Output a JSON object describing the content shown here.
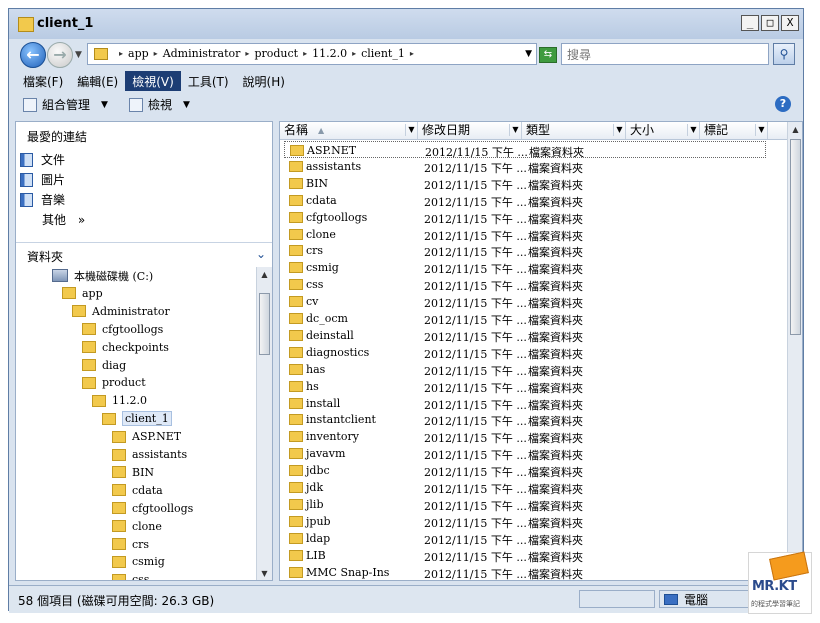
{
  "window": {
    "title": "client_1",
    "buttons": {
      "minimize": "_",
      "maximize": "□",
      "close": "X"
    }
  },
  "address": {
    "breadcrumb": [
      "app",
      "Administrator",
      "product",
      "11.2.0",
      "client_1"
    ],
    "search_placeholder": "搜尋"
  },
  "menubar": [
    "檔案(F)",
    "編輯(E)",
    "檢視(V)",
    "工具(T)",
    "說明(H)"
  ],
  "toolbar": {
    "organize": "組合管理",
    "views": "檢視"
  },
  "favorites": {
    "title": "最愛的連結",
    "items": [
      "文件",
      "圖片",
      "音樂"
    ],
    "more": "其他",
    "more_glyph": "»"
  },
  "folders": {
    "title": "資料夾",
    "tree": [
      {
        "label": "本機磁碟機 (C:)",
        "level": 0,
        "icon": "drive-icon"
      },
      {
        "label": "app",
        "level": 1
      },
      {
        "label": "Administrator",
        "level": 2
      },
      {
        "label": "cfgtoollogs",
        "level": 3
      },
      {
        "label": "checkpoints",
        "level": 3
      },
      {
        "label": "diag",
        "level": 3
      },
      {
        "label": "product",
        "level": 3
      },
      {
        "label": "11.2.0",
        "level": 4
      },
      {
        "label": "client_1",
        "level": 5,
        "selected": true
      },
      {
        "label": "ASP.NET",
        "level": 6
      },
      {
        "label": "assistants",
        "level": 6
      },
      {
        "label": "BIN",
        "level": 6
      },
      {
        "label": "cdata",
        "level": 6
      },
      {
        "label": "cfgtoollogs",
        "level": 6
      },
      {
        "label": "clone",
        "level": 6
      },
      {
        "label": "crs",
        "level": 6
      },
      {
        "label": "csmig",
        "level": 6
      },
      {
        "label": "css",
        "level": 6
      }
    ]
  },
  "columns": [
    "名稱",
    "修改日期",
    "類型",
    "大小",
    "標記"
  ],
  "files": [
    {
      "name": "ASP.NET",
      "date": "2012/11/15 下午 ...",
      "type": "檔案資料夾"
    },
    {
      "name": "assistants",
      "date": "2012/11/15 下午 ...",
      "type": "檔案資料夾"
    },
    {
      "name": "BIN",
      "date": "2012/11/15 下午 ...",
      "type": "檔案資料夾"
    },
    {
      "name": "cdata",
      "date": "2012/11/15 下午 ...",
      "type": "檔案資料夾"
    },
    {
      "name": "cfgtoollogs",
      "date": "2012/11/15 下午 ...",
      "type": "檔案資料夾"
    },
    {
      "name": "clone",
      "date": "2012/11/15 下午 ...",
      "type": "檔案資料夾"
    },
    {
      "name": "crs",
      "date": "2012/11/15 下午 ...",
      "type": "檔案資料夾"
    },
    {
      "name": "csmig",
      "date": "2012/11/15 下午 ...",
      "type": "檔案資料夾"
    },
    {
      "name": "css",
      "date": "2012/11/15 下午 ...",
      "type": "檔案資料夾"
    },
    {
      "name": "cv",
      "date": "2012/11/15 下午 ...",
      "type": "檔案資料夾"
    },
    {
      "name": "dc_ocm",
      "date": "2012/11/15 下午 ...",
      "type": "檔案資料夾"
    },
    {
      "name": "deinstall",
      "date": "2012/11/15 下午 ...",
      "type": "檔案資料夾"
    },
    {
      "name": "diagnostics",
      "date": "2012/11/15 下午 ...",
      "type": "檔案資料夾"
    },
    {
      "name": "has",
      "date": "2012/11/15 下午 ...",
      "type": "檔案資料夾"
    },
    {
      "name": "hs",
      "date": "2012/11/15 下午 ...",
      "type": "檔案資料夾"
    },
    {
      "name": "install",
      "date": "2012/11/15 下午 ...",
      "type": "檔案資料夾"
    },
    {
      "name": "instantclient",
      "date": "2012/11/15 下午 ...",
      "type": "檔案資料夾"
    },
    {
      "name": "inventory",
      "date": "2012/11/15 下午 ...",
      "type": "檔案資料夾"
    },
    {
      "name": "javavm",
      "date": "2012/11/15 下午 ...",
      "type": "檔案資料夾"
    },
    {
      "name": "jdbc",
      "date": "2012/11/15 下午 ...",
      "type": "檔案資料夾"
    },
    {
      "name": "jdk",
      "date": "2012/11/15 下午 ...",
      "type": "檔案資料夾"
    },
    {
      "name": "jlib",
      "date": "2012/11/15 下午 ...",
      "type": "檔案資料夾"
    },
    {
      "name": "jpub",
      "date": "2012/11/15 下午 ...",
      "type": "檔案資料夾"
    },
    {
      "name": "ldap",
      "date": "2012/11/15 下午 ...",
      "type": "檔案資料夾"
    },
    {
      "name": "LIB",
      "date": "2012/11/15 下午 ...",
      "type": "檔案資料夾"
    },
    {
      "name": "MMC Snap-Ins",
      "date": "2012/11/15 下午 ...",
      "type": "檔案資料夾"
    },
    {
      "name": "network",
      "date": "2012/11/15 下午 ...",
      "type": "檔案資料夾"
    }
  ],
  "status": {
    "summary": "58 個項目 (磁碟可用空間: 26.3 GB)",
    "location": "電腦"
  },
  "watermark": {
    "logo": "MR.KT",
    "subtitle": "的程式學習筆記"
  },
  "colors": {
    "folder": "#f2c94c",
    "menu_selected": "#1c3d74",
    "window_frame": "#d9e3ef"
  }
}
